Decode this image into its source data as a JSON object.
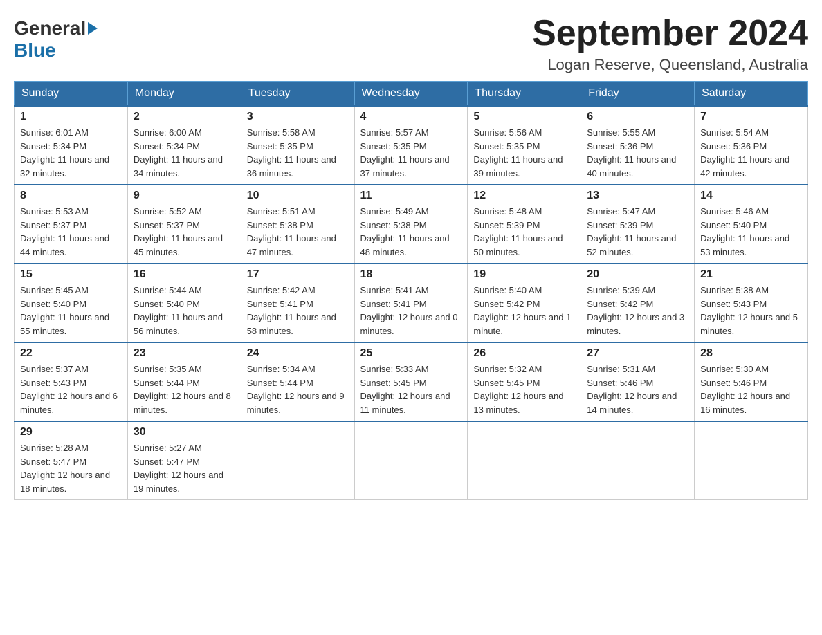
{
  "logo": {
    "line1": "General",
    "line2": "Blue"
  },
  "title": "September 2024",
  "subtitle": "Logan Reserve, Queensland, Australia",
  "days_of_week": [
    "Sunday",
    "Monday",
    "Tuesday",
    "Wednesday",
    "Thursday",
    "Friday",
    "Saturday"
  ],
  "weeks": [
    [
      {
        "day": "1",
        "sunrise": "6:01 AM",
        "sunset": "5:34 PM",
        "daylight": "11 hours and 32 minutes."
      },
      {
        "day": "2",
        "sunrise": "6:00 AM",
        "sunset": "5:34 PM",
        "daylight": "11 hours and 34 minutes."
      },
      {
        "day": "3",
        "sunrise": "5:58 AM",
        "sunset": "5:35 PM",
        "daylight": "11 hours and 36 minutes."
      },
      {
        "day": "4",
        "sunrise": "5:57 AM",
        "sunset": "5:35 PM",
        "daylight": "11 hours and 37 minutes."
      },
      {
        "day": "5",
        "sunrise": "5:56 AM",
        "sunset": "5:35 PM",
        "daylight": "11 hours and 39 minutes."
      },
      {
        "day": "6",
        "sunrise": "5:55 AM",
        "sunset": "5:36 PM",
        "daylight": "11 hours and 40 minutes."
      },
      {
        "day": "7",
        "sunrise": "5:54 AM",
        "sunset": "5:36 PM",
        "daylight": "11 hours and 42 minutes."
      }
    ],
    [
      {
        "day": "8",
        "sunrise": "5:53 AM",
        "sunset": "5:37 PM",
        "daylight": "11 hours and 44 minutes."
      },
      {
        "day": "9",
        "sunrise": "5:52 AM",
        "sunset": "5:37 PM",
        "daylight": "11 hours and 45 minutes."
      },
      {
        "day": "10",
        "sunrise": "5:51 AM",
        "sunset": "5:38 PM",
        "daylight": "11 hours and 47 minutes."
      },
      {
        "day": "11",
        "sunrise": "5:49 AM",
        "sunset": "5:38 PM",
        "daylight": "11 hours and 48 minutes."
      },
      {
        "day": "12",
        "sunrise": "5:48 AM",
        "sunset": "5:39 PM",
        "daylight": "11 hours and 50 minutes."
      },
      {
        "day": "13",
        "sunrise": "5:47 AM",
        "sunset": "5:39 PM",
        "daylight": "11 hours and 52 minutes."
      },
      {
        "day": "14",
        "sunrise": "5:46 AM",
        "sunset": "5:40 PM",
        "daylight": "11 hours and 53 minutes."
      }
    ],
    [
      {
        "day": "15",
        "sunrise": "5:45 AM",
        "sunset": "5:40 PM",
        "daylight": "11 hours and 55 minutes."
      },
      {
        "day": "16",
        "sunrise": "5:44 AM",
        "sunset": "5:40 PM",
        "daylight": "11 hours and 56 minutes."
      },
      {
        "day": "17",
        "sunrise": "5:42 AM",
        "sunset": "5:41 PM",
        "daylight": "11 hours and 58 minutes."
      },
      {
        "day": "18",
        "sunrise": "5:41 AM",
        "sunset": "5:41 PM",
        "daylight": "12 hours and 0 minutes."
      },
      {
        "day": "19",
        "sunrise": "5:40 AM",
        "sunset": "5:42 PM",
        "daylight": "12 hours and 1 minute."
      },
      {
        "day": "20",
        "sunrise": "5:39 AM",
        "sunset": "5:42 PM",
        "daylight": "12 hours and 3 minutes."
      },
      {
        "day": "21",
        "sunrise": "5:38 AM",
        "sunset": "5:43 PM",
        "daylight": "12 hours and 5 minutes."
      }
    ],
    [
      {
        "day": "22",
        "sunrise": "5:37 AM",
        "sunset": "5:43 PM",
        "daylight": "12 hours and 6 minutes."
      },
      {
        "day": "23",
        "sunrise": "5:35 AM",
        "sunset": "5:44 PM",
        "daylight": "12 hours and 8 minutes."
      },
      {
        "day": "24",
        "sunrise": "5:34 AM",
        "sunset": "5:44 PM",
        "daylight": "12 hours and 9 minutes."
      },
      {
        "day": "25",
        "sunrise": "5:33 AM",
        "sunset": "5:45 PM",
        "daylight": "12 hours and 11 minutes."
      },
      {
        "day": "26",
        "sunrise": "5:32 AM",
        "sunset": "5:45 PM",
        "daylight": "12 hours and 13 minutes."
      },
      {
        "day": "27",
        "sunrise": "5:31 AM",
        "sunset": "5:46 PM",
        "daylight": "12 hours and 14 minutes."
      },
      {
        "day": "28",
        "sunrise": "5:30 AM",
        "sunset": "5:46 PM",
        "daylight": "12 hours and 16 minutes."
      }
    ],
    [
      {
        "day": "29",
        "sunrise": "5:28 AM",
        "sunset": "5:47 PM",
        "daylight": "12 hours and 18 minutes."
      },
      {
        "day": "30",
        "sunrise": "5:27 AM",
        "sunset": "5:47 PM",
        "daylight": "12 hours and 19 minutes."
      },
      null,
      null,
      null,
      null,
      null
    ]
  ],
  "labels": {
    "sunrise": "Sunrise:",
    "sunset": "Sunset:",
    "daylight": "Daylight:"
  }
}
